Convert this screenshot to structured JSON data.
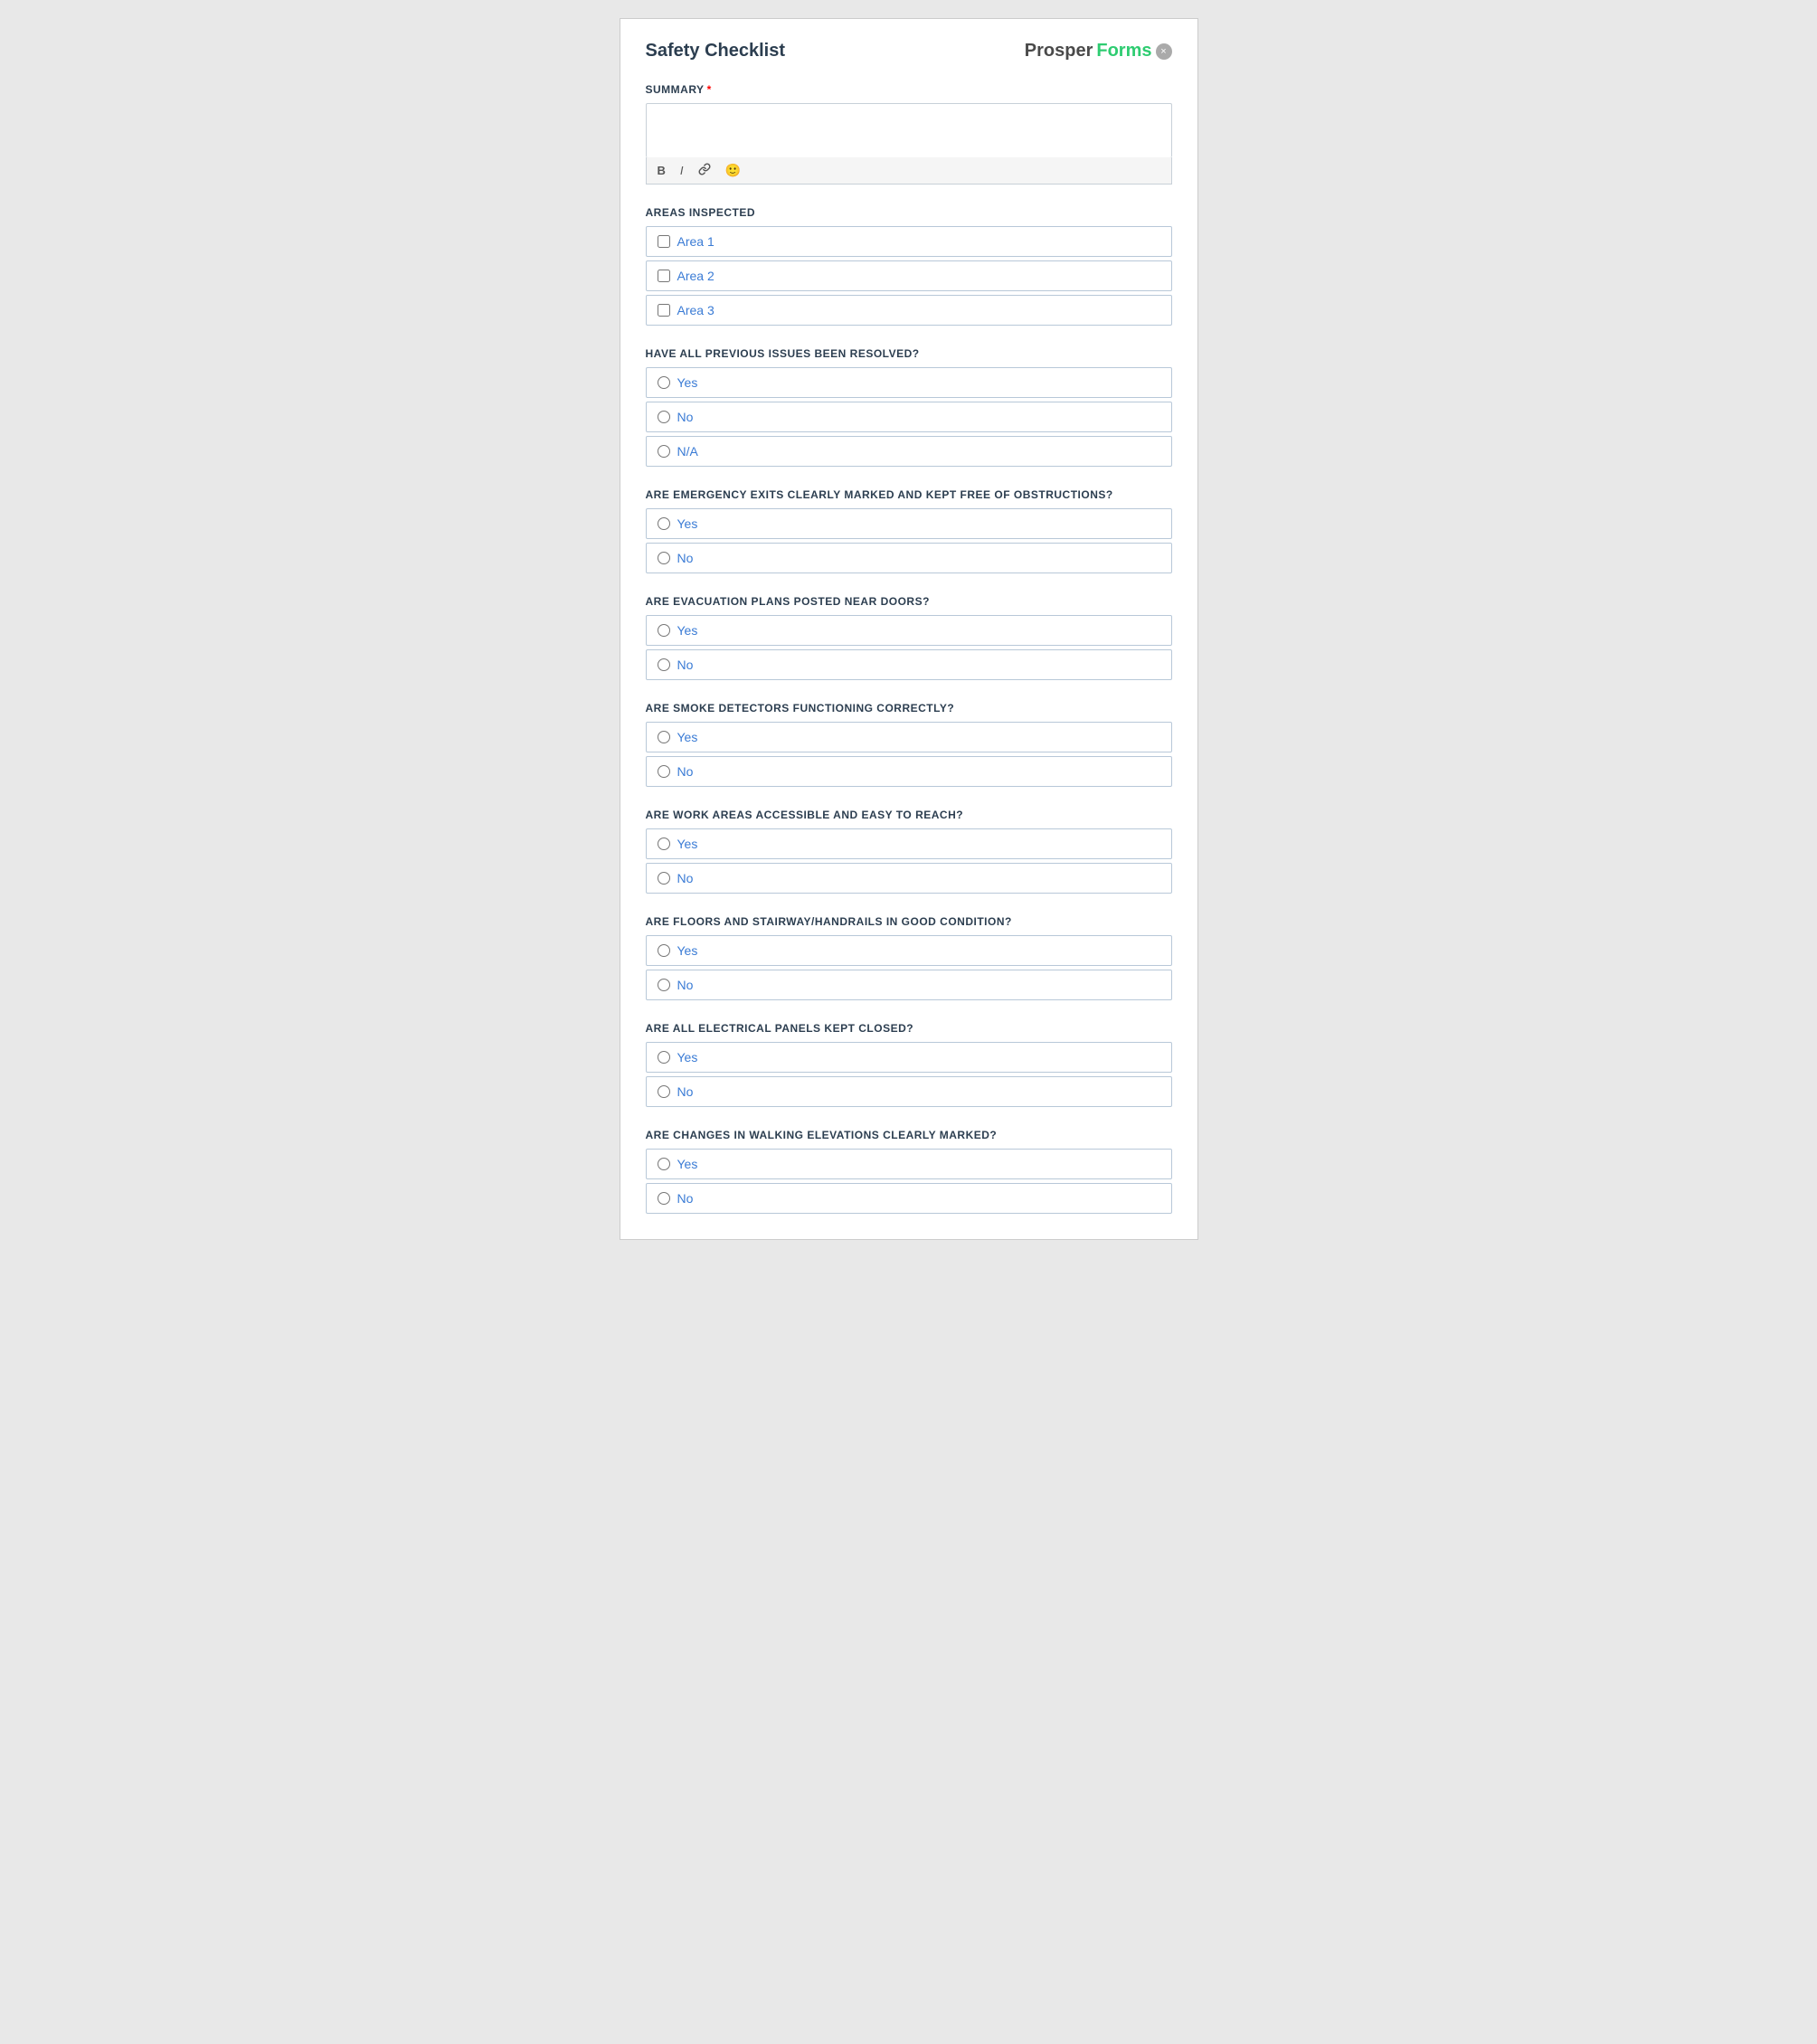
{
  "header": {
    "title": "Safety Checklist",
    "brand_prosper": "Prosper",
    "brand_forms": "Forms",
    "close_icon": "×"
  },
  "summary": {
    "label": "SUMMARY",
    "required": true,
    "placeholder": "",
    "toolbar": {
      "bold": "B",
      "italic": "I",
      "link": "🔗",
      "emoji": "😊"
    }
  },
  "sections": [
    {
      "id": "areas_inspected",
      "label": "AREAS INSPECTED",
      "type": "checkbox",
      "options": [
        "Area 1",
        "Area 2",
        "Area 3"
      ]
    },
    {
      "id": "previous_issues",
      "label": "HAVE ALL PREVIOUS ISSUES BEEN RESOLVED?",
      "type": "radio",
      "options": [
        "Yes",
        "No",
        "N/A"
      ]
    },
    {
      "id": "emergency_exits",
      "label": "ARE EMERGENCY EXITS CLEARLY MARKED AND KEPT FREE OF OBSTRUCTIONS?",
      "type": "radio",
      "options": [
        "Yes",
        "No"
      ]
    },
    {
      "id": "evacuation_plans",
      "label": "ARE EVACUATION PLANS POSTED NEAR DOORS?",
      "type": "radio",
      "options": [
        "Yes",
        "No"
      ]
    },
    {
      "id": "smoke_detectors",
      "label": "ARE SMOKE DETECTORS FUNCTIONING CORRECTLY?",
      "type": "radio",
      "options": [
        "Yes",
        "No"
      ]
    },
    {
      "id": "work_areas",
      "label": "ARE WORK AREAS ACCESSIBLE AND EASY TO REACH?",
      "type": "radio",
      "options": [
        "Yes",
        "No"
      ]
    },
    {
      "id": "floors_stairway",
      "label": "ARE FLOORS AND STAIRWAY/HANDRAILS IN GOOD CONDITION?",
      "type": "radio",
      "options": [
        "Yes",
        "No"
      ]
    },
    {
      "id": "electrical_panels",
      "label": "ARE ALL ELECTRICAL PANELS KEPT CLOSED?",
      "type": "radio",
      "options": [
        "Yes",
        "No"
      ]
    },
    {
      "id": "walking_elevations",
      "label": "ARE CHANGES IN WALKING ELEVATIONS CLEARLY MARKED?",
      "type": "radio",
      "options": [
        "Yes",
        "No"
      ]
    }
  ]
}
